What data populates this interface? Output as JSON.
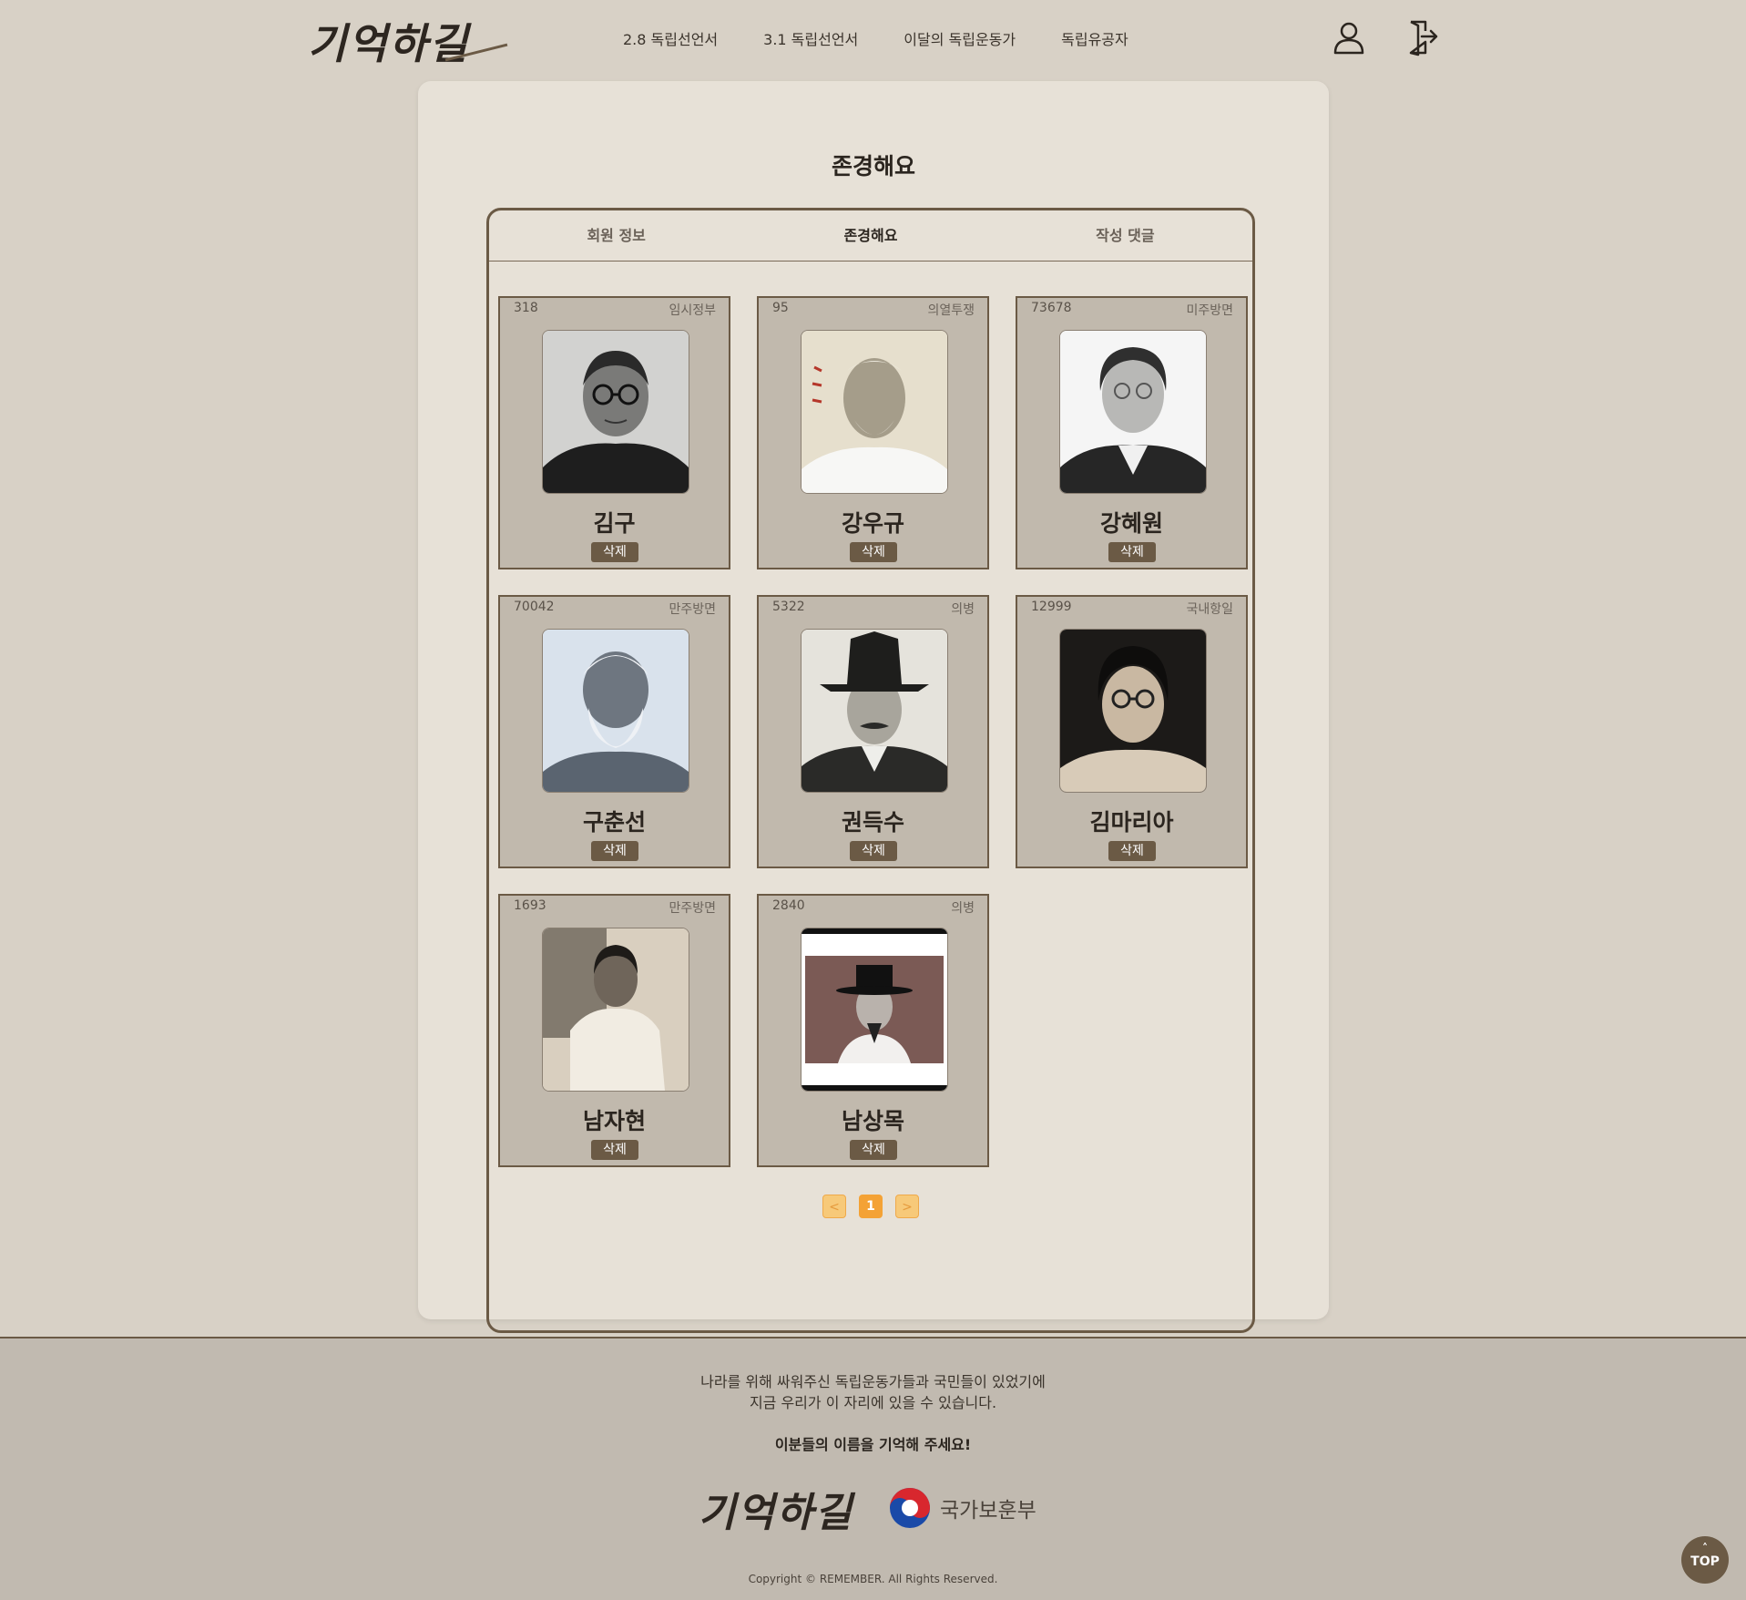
{
  "header": {
    "logo_text": "기억하길",
    "nav": [
      "2.8 독립선언서",
      "3.1 독립선언서",
      "이달의 독립운동가",
      "독립유공자"
    ],
    "icons": {
      "user": "user-icon",
      "logout": "logout-icon"
    }
  },
  "main": {
    "title": "존경해요",
    "tabs": [
      {
        "label": "회원 정보",
        "active": false
      },
      {
        "label": "존경해요",
        "active": true
      },
      {
        "label": "작성 댓글",
        "active": false
      }
    ],
    "cards": [
      {
        "num": "318",
        "category": "임시정부",
        "name": "김구",
        "delete_label": "삭제"
      },
      {
        "num": "95",
        "category": "의열투쟁",
        "name": "강우규",
        "delete_label": "삭제"
      },
      {
        "num": "73678",
        "category": "미주방면",
        "name": "강혜원",
        "delete_label": "삭제"
      },
      {
        "num": "70042",
        "category": "만주방면",
        "name": "구춘선",
        "delete_label": "삭제"
      },
      {
        "num": "5322",
        "category": "의병",
        "name": "권득수",
        "delete_label": "삭제"
      },
      {
        "num": "12999",
        "category": "국내항일",
        "name": "김마리아",
        "delete_label": "삭제"
      },
      {
        "num": "1693",
        "category": "만주방면",
        "name": "남자현",
        "delete_label": "삭제"
      },
      {
        "num": "2840",
        "category": "의병",
        "name": "남상목",
        "delete_label": "삭제"
      }
    ],
    "pagination": {
      "prev": "<",
      "current": "1",
      "next": ">"
    }
  },
  "footer": {
    "line1": "나라를 위해 싸워주신 독립운동가들과 국민들이 있었기에",
    "line2": "지금 우리가 이 자리에 있을 수 있습니다.",
    "emphasis": "이분들의 이름을 기억해 주세요!",
    "logo_text": "기억하길",
    "ministry": "국가보훈부",
    "copyright": "Copyright © REMEMBER. All Rights Reserved.",
    "top_label": "TOP"
  },
  "colors": {
    "accent": "#6b5a45",
    "page_bg": "#d8d1c6",
    "panel_bg": "#e7e1d7",
    "card_bg": "#c1b9ad",
    "pager": "#f4a235"
  }
}
